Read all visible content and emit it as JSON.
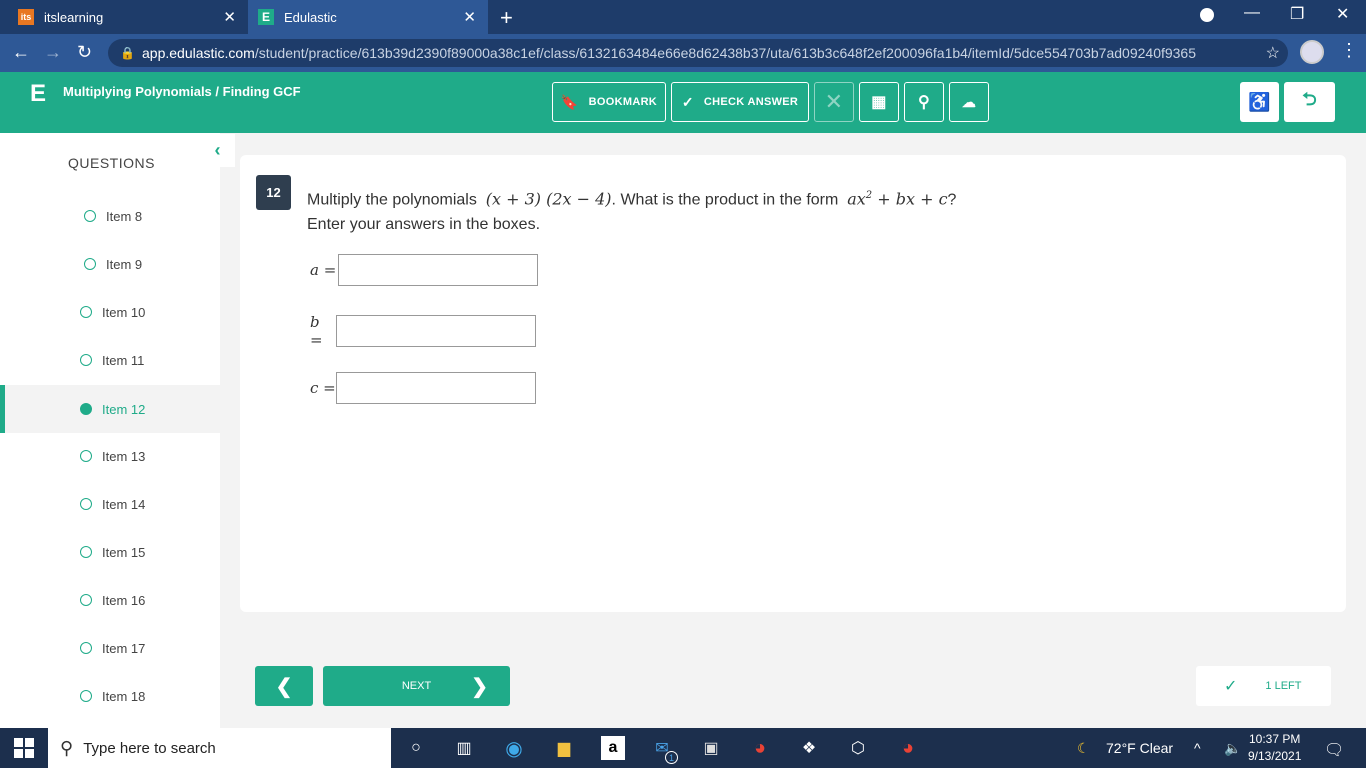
{
  "browser": {
    "tabs": [
      {
        "label": "itslearning",
        "favicon": "its"
      },
      {
        "label": "Edulastic",
        "favicon": "E"
      }
    ],
    "url_domain": "app.edulastic.com",
    "url_path": "/student/practice/613b39d2390f89000a38c1ef/class/6132163484e66e8d62438b37/uta/613b3c648f2ef200096fa1b4/itemId/5dce554703b7ad09240f9365"
  },
  "header": {
    "logo": "E",
    "title": "Multiplying Polynomials / Finding GCF",
    "bookmark_label": "BOOKMARK",
    "check_label": "CHECK ANSWER"
  },
  "sidebar": {
    "heading": "QUESTIONS",
    "items": [
      {
        "label": "Item 8"
      },
      {
        "label": "Item 9"
      },
      {
        "label": "Item 10"
      },
      {
        "label": "Item 11"
      },
      {
        "label": "Item 12"
      },
      {
        "label": "Item 13"
      },
      {
        "label": "Item 14"
      },
      {
        "label": "Item 15"
      },
      {
        "label": "Item 16"
      },
      {
        "label": "Item 17"
      },
      {
        "label": "Item 18"
      }
    ]
  },
  "question": {
    "number": "12",
    "text_before": "Multiply the polynomials",
    "expression": "(x + 3) (2x − 4)",
    "text_mid": ". What is the product in the form",
    "form_a": "ax",
    "form_exp": "2",
    "form_rest": " + bx + c",
    "text_end": "?",
    "instruction": "Enter your answers in the boxes.",
    "answers": [
      {
        "label": "a =",
        "value": ""
      },
      {
        "label": "b =",
        "value": ""
      },
      {
        "label": "c =",
        "value": ""
      }
    ]
  },
  "footer": {
    "next_label": "NEXT",
    "left_label": "1 LEFT"
  },
  "taskbar": {
    "search_placeholder": "Type here to search",
    "weather": "72°F  Clear",
    "mail_badge": "1",
    "time": "10:37 PM",
    "date": "9/13/2021"
  }
}
